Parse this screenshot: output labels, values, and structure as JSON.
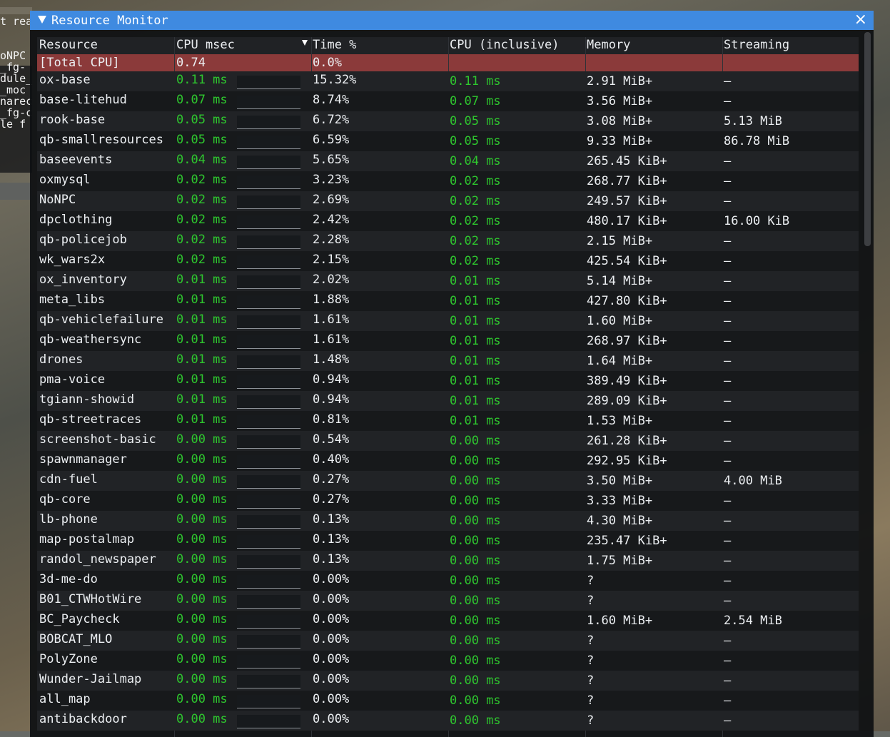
{
  "background": {
    "lines": [
      "t rea",
      "",
      "",
      "oNPC",
      "_fg-",
      "dule_",
      "_moc",
      "narec",
      "_fg-c",
      "le_f"
    ]
  },
  "window": {
    "title": "Resource Monitor",
    "title_bar_color": "#3f8ae0",
    "total_row_color": "#8b3a3a",
    "ms_value_color": "#2ec72e"
  },
  "columns": [
    "Resource",
    "CPU msec",
    "Time %",
    "CPU (inclusive)",
    "Memory",
    "Streaming"
  ],
  "sorted_column": "Time %",
  "total": {
    "name": "[Total CPU]",
    "cpu": "0.74",
    "time": "0.0%",
    "incl": "",
    "mem": "",
    "stream": ""
  },
  "rows": [
    {
      "name": "ox-base",
      "cpu": "0.11 ms",
      "time": "15.32%",
      "incl": "0.11 ms",
      "mem": "2.91 MiB+",
      "stream": "–"
    },
    {
      "name": "base-litehud",
      "cpu": "0.07 ms",
      "time": "8.74%",
      "incl": "0.07 ms",
      "mem": "3.56 MiB+",
      "stream": "–"
    },
    {
      "name": "rook-base",
      "cpu": "0.05 ms",
      "time": "6.72%",
      "incl": "0.05 ms",
      "mem": "3.08 MiB+",
      "stream": "5.13 MiB"
    },
    {
      "name": "qb-smallresources",
      "cpu": "0.05 ms",
      "time": "6.59%",
      "incl": "0.05 ms",
      "mem": "9.33 MiB+",
      "stream": "86.78 MiB"
    },
    {
      "name": "baseevents",
      "cpu": "0.04 ms",
      "time": "5.65%",
      "incl": "0.04 ms",
      "mem": "265.45 KiB+",
      "stream": "–"
    },
    {
      "name": "oxmysql",
      "cpu": "0.02 ms",
      "time": "3.23%",
      "incl": "0.02 ms",
      "mem": "268.77 KiB+",
      "stream": "–"
    },
    {
      "name": "NoNPC",
      "cpu": "0.02 ms",
      "time": "2.69%",
      "incl": "0.02 ms",
      "mem": "249.57 KiB+",
      "stream": "–"
    },
    {
      "name": "dpclothing",
      "cpu": "0.02 ms",
      "time": "2.42%",
      "incl": "0.02 ms",
      "mem": "480.17 KiB+",
      "stream": "16.00 KiB"
    },
    {
      "name": "qb-policejob",
      "cpu": "0.02 ms",
      "time": "2.28%",
      "incl": "0.02 ms",
      "mem": "2.15 MiB+",
      "stream": "–"
    },
    {
      "name": "wk_wars2x",
      "cpu": "0.02 ms",
      "time": "2.15%",
      "incl": "0.02 ms",
      "mem": "425.54 KiB+",
      "stream": "–"
    },
    {
      "name": "ox_inventory",
      "cpu": "0.01 ms",
      "time": "2.02%",
      "incl": "0.01 ms",
      "mem": "5.14 MiB+",
      "stream": "–"
    },
    {
      "name": "meta_libs",
      "cpu": "0.01 ms",
      "time": "1.88%",
      "incl": "0.01 ms",
      "mem": "427.80 KiB+",
      "stream": "–"
    },
    {
      "name": "qb-vehiclefailure",
      "cpu": "0.01 ms",
      "time": "1.61%",
      "incl": "0.01 ms",
      "mem": "1.60 MiB+",
      "stream": "–"
    },
    {
      "name": "qb-weathersync",
      "cpu": "0.01 ms",
      "time": "1.61%",
      "incl": "0.01 ms",
      "mem": "268.97 KiB+",
      "stream": "–"
    },
    {
      "name": "drones",
      "cpu": "0.01 ms",
      "time": "1.48%",
      "incl": "0.01 ms",
      "mem": "1.64 MiB+",
      "stream": "–"
    },
    {
      "name": "pma-voice",
      "cpu": "0.01 ms",
      "time": "0.94%",
      "incl": "0.01 ms",
      "mem": "389.49 KiB+",
      "stream": "–"
    },
    {
      "name": "tgiann-showid",
      "cpu": "0.01 ms",
      "time": "0.94%",
      "incl": "0.01 ms",
      "mem": "289.09 KiB+",
      "stream": "–"
    },
    {
      "name": "qb-streetraces",
      "cpu": "0.01 ms",
      "time": "0.81%",
      "incl": "0.01 ms",
      "mem": "1.53 MiB+",
      "stream": "–"
    },
    {
      "name": "screenshot-basic",
      "cpu": "0.00 ms",
      "time": "0.54%",
      "incl": "0.00 ms",
      "mem": "261.28 KiB+",
      "stream": "–"
    },
    {
      "name": "spawnmanager",
      "cpu": "0.00 ms",
      "time": "0.40%",
      "incl": "0.00 ms",
      "mem": "292.95 KiB+",
      "stream": "–"
    },
    {
      "name": "cdn-fuel",
      "cpu": "0.00 ms",
      "time": "0.27%",
      "incl": "0.00 ms",
      "mem": "3.50 MiB+",
      "stream": "4.00 MiB"
    },
    {
      "name": "qb-core",
      "cpu": "0.00 ms",
      "time": "0.27%",
      "incl": "0.00 ms",
      "mem": "3.33 MiB+",
      "stream": "–"
    },
    {
      "name": "lb-phone",
      "cpu": "0.00 ms",
      "time": "0.13%",
      "incl": "0.00 ms",
      "mem": "4.30 MiB+",
      "stream": "–"
    },
    {
      "name": "map-postalmap",
      "cpu": "0.00 ms",
      "time": "0.13%",
      "incl": "0.00 ms",
      "mem": "235.47 KiB+",
      "stream": "–"
    },
    {
      "name": "randol_newspaper",
      "cpu": "0.00 ms",
      "time": "0.13%",
      "incl": "0.00 ms",
      "mem": "1.75 MiB+",
      "stream": "–"
    },
    {
      "name": "3d-me-do",
      "cpu": "0.00 ms",
      "time": "0.00%",
      "incl": "0.00 ms",
      "mem": "?",
      "stream": "–"
    },
    {
      "name": "B01_CTWHotWire",
      "cpu": "0.00 ms",
      "time": "0.00%",
      "incl": "0.00 ms",
      "mem": "?",
      "stream": "–"
    },
    {
      "name": "BC_Paycheck",
      "cpu": "0.00 ms",
      "time": "0.00%",
      "incl": "0.00 ms",
      "mem": "1.60 MiB+",
      "stream": "2.54 MiB"
    },
    {
      "name": "BOBCAT_MLO",
      "cpu": "0.00 ms",
      "time": "0.00%",
      "incl": "0.00 ms",
      "mem": "?",
      "stream": "–"
    },
    {
      "name": "PolyZone",
      "cpu": "0.00 ms",
      "time": "0.00%",
      "incl": "0.00 ms",
      "mem": "?",
      "stream": "–"
    },
    {
      "name": "Wunder-Jailmap",
      "cpu": "0.00 ms",
      "time": "0.00%",
      "incl": "0.00 ms",
      "mem": "?",
      "stream": "–"
    },
    {
      "name": "all_map",
      "cpu": "0.00 ms",
      "time": "0.00%",
      "incl": "0.00 ms",
      "mem": "?",
      "stream": "–"
    },
    {
      "name": "antibackdoor",
      "cpu": "0.00 ms",
      "time": "0.00%",
      "incl": "0.00 ms",
      "mem": "?",
      "stream": "–"
    }
  ]
}
